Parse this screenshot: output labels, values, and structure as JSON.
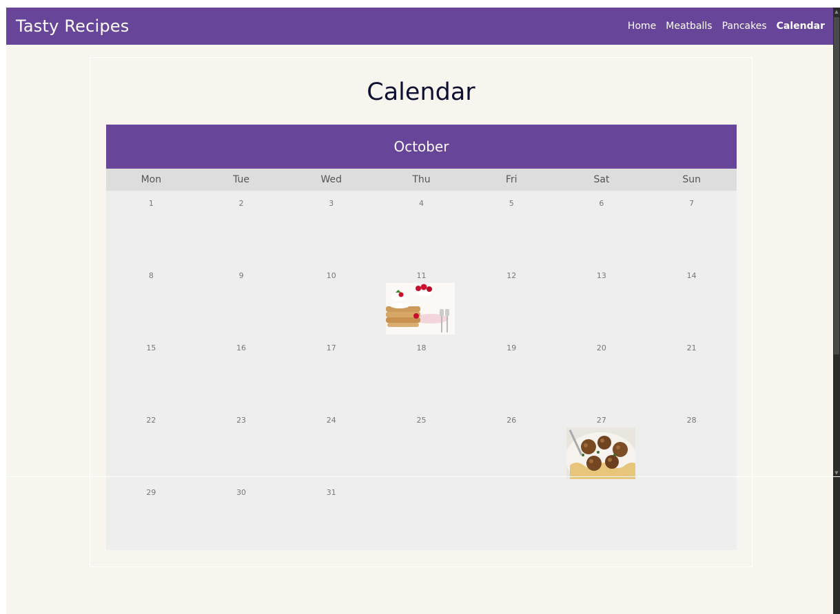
{
  "nav": {
    "brand": "Tasty Recipes",
    "links": [
      "Home",
      "Meatballs",
      "Pancakes",
      "Calendar"
    ],
    "active": "Calendar"
  },
  "main": {
    "title": "Calendar",
    "month": "October",
    "weekdays": [
      "Mon",
      "Tue",
      "Wed",
      "Thu",
      "Fri",
      "Sat",
      "Sun"
    ],
    "days": [
      "1",
      "2",
      "3",
      "4",
      "5",
      "6",
      "7",
      "8",
      "9",
      "10",
      "11",
      "12",
      "13",
      "14",
      "15",
      "16",
      "17",
      "18",
      "19",
      "20",
      "21",
      "22",
      "23",
      "24",
      "25",
      "26",
      "27",
      "28",
      "29",
      "30",
      "31"
    ],
    "events": [
      {
        "day": "11",
        "recipe": "pancakes-image"
      },
      {
        "day": "27",
        "recipe": "meatballs-image"
      }
    ]
  },
  "colors": {
    "brand_purple": "#674599",
    "page_bg": "#f8f5ee",
    "calendar_bg": "#eeeeee",
    "weekday_bg": "#dddddd"
  }
}
